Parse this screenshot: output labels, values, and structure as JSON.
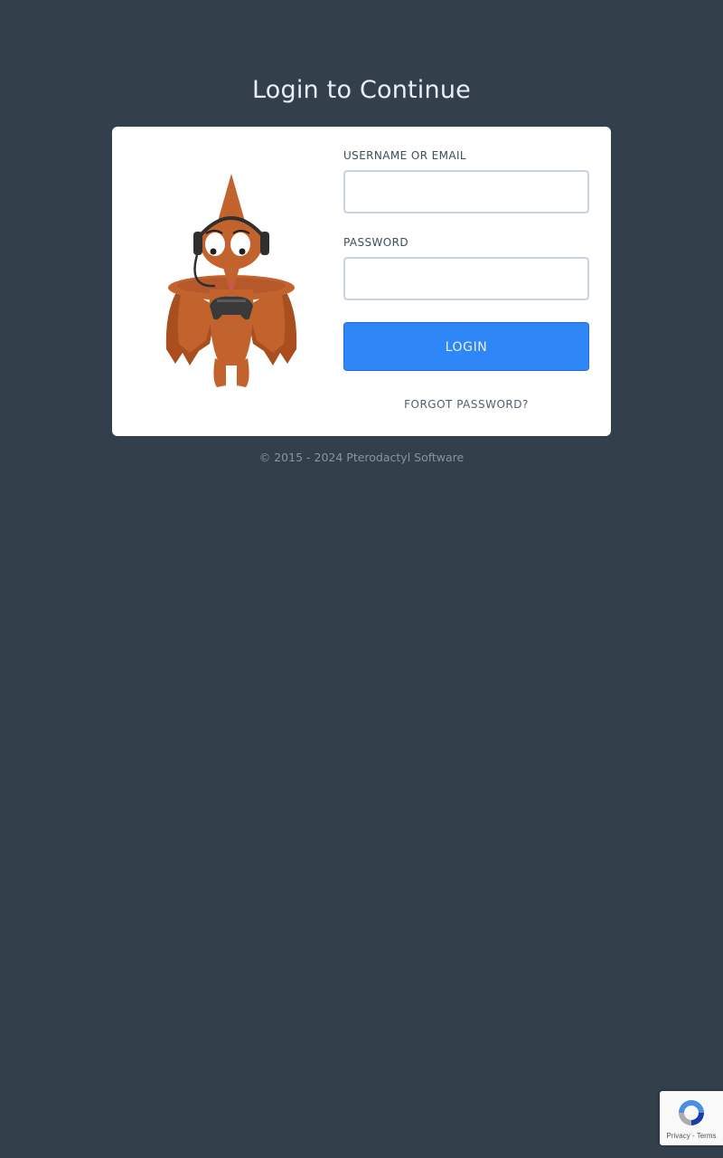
{
  "page": {
    "title": "Login to Continue"
  },
  "form": {
    "username_label": "USERNAME OR EMAIL",
    "username_value": "",
    "password_label": "PASSWORD",
    "password_value": "",
    "login_label": "LOGIN",
    "forgot_label": "FORGOT PASSWORD?"
  },
  "footer": {
    "copyright": "© 2015 - 2024 ",
    "brand": "Pterodactyl Software"
  },
  "recaptcha": {
    "privacy": "Privacy",
    "separator": " - ",
    "terms": "Terms"
  },
  "colors": {
    "background": "#333f4b",
    "card": "#ffffff",
    "primary_button": "#2f86f6",
    "mascot": "#c2622d"
  },
  "icons": {
    "mascot": "pterodactyl-gamer-mascot",
    "recaptcha": "recaptcha-logo-icon"
  }
}
